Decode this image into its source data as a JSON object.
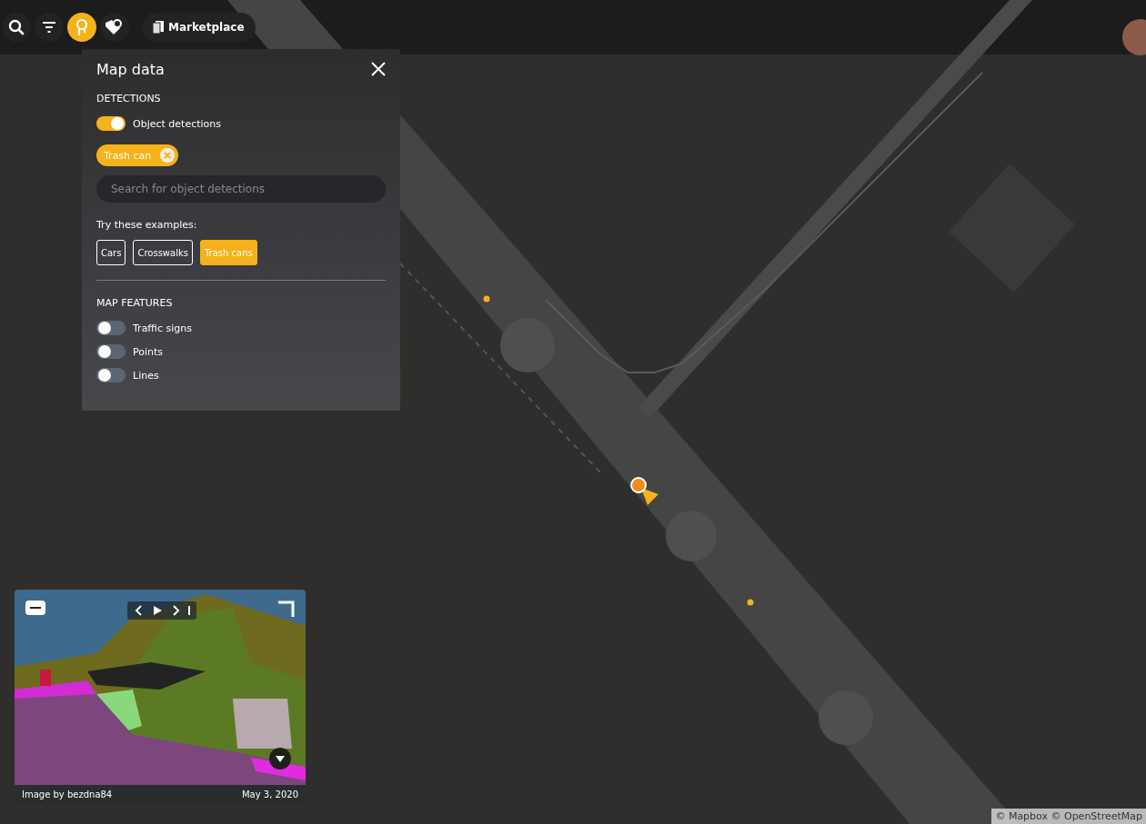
{
  "toolbar": {
    "tools": [
      {
        "kind": "search",
        "selected": false
      },
      {
        "kind": "filter",
        "selected": false
      },
      {
        "kind": "map-data",
        "selected": true
      },
      {
        "kind": "tag-search",
        "selected": false
      }
    ],
    "marketplace": "Marketplace"
  },
  "panel": {
    "title": "Map data",
    "detections": {
      "heading": "DETECTIONS",
      "toggle": {
        "label": "Object detections",
        "on": true
      },
      "chips": [
        {
          "label": "Trash can"
        }
      ],
      "search": {
        "placeholder": "Search for object detections"
      },
      "examples_label": "Try these examples:",
      "examples": [
        {
          "label": "Cars",
          "selected": false
        },
        {
          "label": "Crosswalks",
          "selected": false
        },
        {
          "label": "Trash cans",
          "selected": true
        }
      ]
    },
    "features": {
      "heading": "MAP FEATURES",
      "toggles": [
        {
          "label": "Traffic signs",
          "on": false
        },
        {
          "label": "Points",
          "on": false
        },
        {
          "label": "Lines",
          "on": false
        }
      ]
    }
  },
  "viewer": {
    "credit": "Image by bezdna84",
    "date": "May 3, 2020"
  },
  "attribution": "© Mapbox © OpenStreetMap"
}
